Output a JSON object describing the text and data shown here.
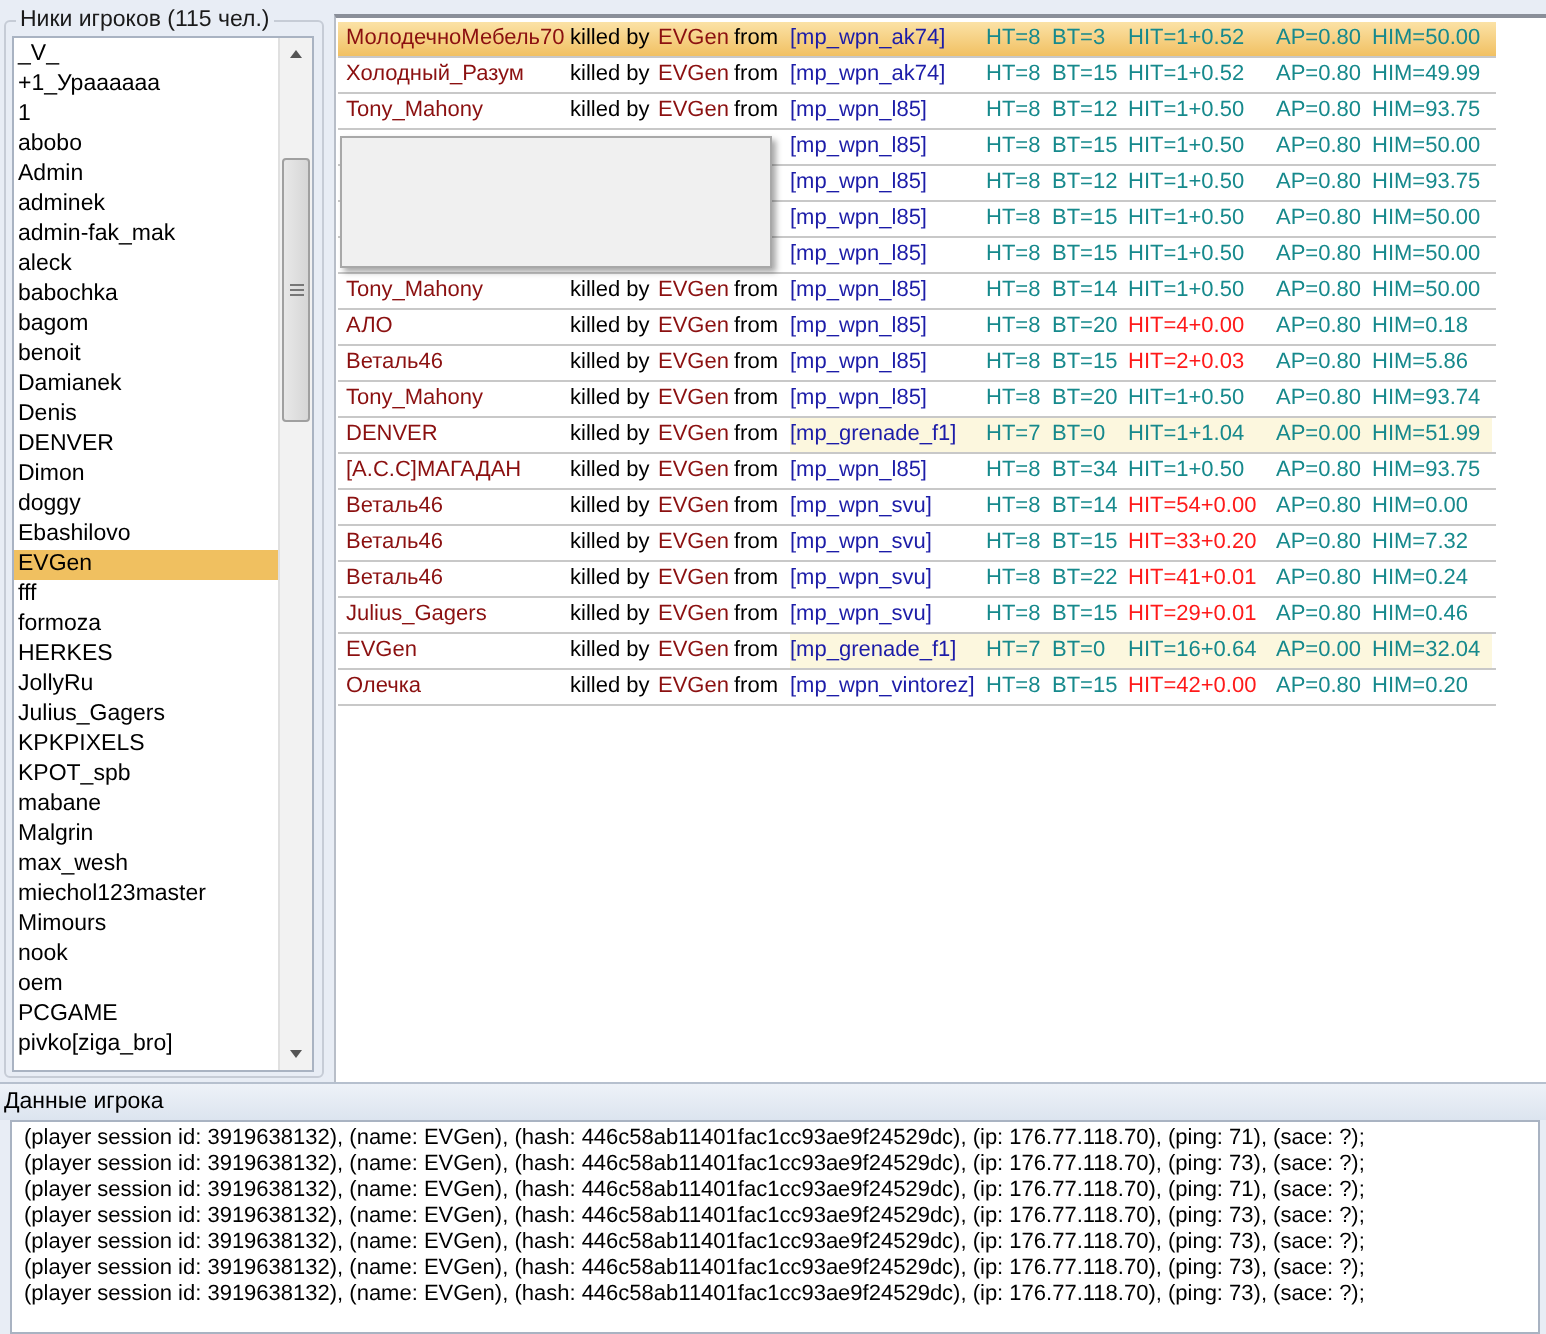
{
  "players_panel": {
    "title": "Ники игроков (115 чел.)",
    "items": [
      {
        "label": "_V_",
        "selected": false
      },
      {
        "label": "+1_Ураааааа",
        "selected": false
      },
      {
        "label": "1",
        "selected": false
      },
      {
        "label": "abobo",
        "selected": false
      },
      {
        "label": "Admin",
        "selected": false
      },
      {
        "label": "adminek",
        "selected": false
      },
      {
        "label": "admin-fak_mak",
        "selected": false
      },
      {
        "label": "aleck",
        "selected": false
      },
      {
        "label": "babochka",
        "selected": false
      },
      {
        "label": "bagom",
        "selected": false
      },
      {
        "label": "benoit",
        "selected": false
      },
      {
        "label": "Damianek",
        "selected": false
      },
      {
        "label": "Denis",
        "selected": false
      },
      {
        "label": "DENVER",
        "selected": false
      },
      {
        "label": "Dimon",
        "selected": false
      },
      {
        "label": "doggy",
        "selected": false
      },
      {
        "label": "Ebashilovo",
        "selected": false
      },
      {
        "label": "EVGen",
        "selected": true
      },
      {
        "label": "fff",
        "selected": false
      },
      {
        "label": "formoza",
        "selected": false
      },
      {
        "label": "HERKES",
        "selected": false
      },
      {
        "label": "JollyRu",
        "selected": false
      },
      {
        "label": "Julius_Gagers",
        "selected": false
      },
      {
        "label": "KPKPIXELS",
        "selected": false
      },
      {
        "label": "KPOT_spb",
        "selected": false
      },
      {
        "label": "mabane",
        "selected": false
      },
      {
        "label": "Malgrin",
        "selected": false
      },
      {
        "label": "max_wesh",
        "selected": false
      },
      {
        "label": "miechol123master",
        "selected": false
      },
      {
        "label": "Mimours",
        "selected": false
      },
      {
        "label": "nook",
        "selected": false
      },
      {
        "label": "oem",
        "selected": false
      },
      {
        "label": "PCGAME",
        "selected": false
      },
      {
        "label": "pivko[ziga_bro]",
        "selected": false
      }
    ]
  },
  "kills": [
    {
      "victim": "МолодечноМебель70",
      "verb": "killed by",
      "killer": "EVGen",
      "prep": "from",
      "weapon": "[mp_wpn_ak74]",
      "ht": "HT=8",
      "bt": "BT=3",
      "hit": "HIT=1+0.52",
      "ap": "AP=0.80",
      "him": "HIM=50.00",
      "hit_alert": false,
      "tinted": false,
      "selected": true
    },
    {
      "victim": "Холодный_Разум",
      "verb": "killed by",
      "killer": "EVGen",
      "prep": "from",
      "weapon": "[mp_wpn_ak74]",
      "ht": "HT=8",
      "bt": "BT=15",
      "hit": "HIT=1+0.52",
      "ap": "AP=0.80",
      "him": "HIM=49.99",
      "hit_alert": false,
      "tinted": false,
      "selected": false
    },
    {
      "victim": "Tony_Mahony",
      "verb": "killed by",
      "killer": "EVGen",
      "prep": "from",
      "weapon": "[mp_wpn_l85]",
      "ht": "HT=8",
      "bt": "BT=12",
      "hit": "HIT=1+0.50",
      "ap": "AP=0.80",
      "him": "HIM=93.75",
      "hit_alert": false,
      "tinted": false,
      "selected": false
    },
    {
      "weapon": "[mp_wpn_l85]",
      "ht": "HT=8",
      "bt": "BT=15",
      "hit": "HIT=1+0.50",
      "ap": "AP=0.80",
      "him": "HIM=50.00",
      "hit_alert": false,
      "tinted": false,
      "selected": false
    },
    {
      "weapon": "[mp_wpn_l85]",
      "ht": "HT=8",
      "bt": "BT=12",
      "hit": "HIT=1+0.50",
      "ap": "AP=0.80",
      "him": "HIM=93.75",
      "hit_alert": false,
      "tinted": false,
      "selected": false
    },
    {
      "weapon": "[mp_wpn_l85]",
      "ht": "HT=8",
      "bt": "BT=15",
      "hit": "HIT=1+0.50",
      "ap": "AP=0.80",
      "him": "HIM=50.00",
      "hit_alert": false,
      "tinted": false,
      "selected": false
    },
    {
      "weapon": "[mp_wpn_l85]",
      "ht": "HT=8",
      "bt": "BT=15",
      "hit": "HIT=1+0.50",
      "ap": "AP=0.80",
      "him": "HIM=50.00",
      "hit_alert": false,
      "tinted": false,
      "selected": false
    },
    {
      "victim": "Tony_Mahony",
      "verb": "killed by",
      "killer": "EVGen",
      "prep": "from",
      "weapon": "[mp_wpn_l85]",
      "ht": "HT=8",
      "bt": "BT=14",
      "hit": "HIT=1+0.50",
      "ap": "AP=0.80",
      "him": "HIM=50.00",
      "hit_alert": false,
      "tinted": false,
      "selected": false
    },
    {
      "victim": "АЛО",
      "verb": "killed by",
      "killer": "EVGen",
      "prep": "from",
      "weapon": "[mp_wpn_l85]",
      "ht": "HT=8",
      "bt": "BT=20",
      "hit": "HIT=4+0.00",
      "ap": "AP=0.80",
      "him": "HIM=0.18",
      "hit_alert": true,
      "tinted": false,
      "selected": false
    },
    {
      "victim": "Веталь46",
      "verb": "killed by",
      "killer": "EVGen",
      "prep": "from",
      "weapon": "[mp_wpn_l85]",
      "ht": "HT=8",
      "bt": "BT=15",
      "hit": "HIT=2+0.03",
      "ap": "AP=0.80",
      "him": "HIM=5.86",
      "hit_alert": true,
      "tinted": false,
      "selected": false
    },
    {
      "victim": "Tony_Mahony",
      "verb": "killed by",
      "killer": "EVGen",
      "prep": "from",
      "weapon": "[mp_wpn_l85]",
      "ht": "HT=8",
      "bt": "BT=20",
      "hit": "HIT=1+0.50",
      "ap": "AP=0.80",
      "him": "HIM=93.74",
      "hit_alert": false,
      "tinted": false,
      "selected": false
    },
    {
      "victim": "DENVER",
      "verb": "killed by",
      "killer": "EVGen",
      "prep": "from",
      "weapon": "[mp_grenade_f1]",
      "ht": "HT=7",
      "bt": "BT=0",
      "hit": "HIT=1+1.04",
      "ap": "AP=0.00",
      "him": "HIM=51.99",
      "hit_alert": false,
      "tinted": true,
      "selected": false
    },
    {
      "victim": "[A.C.C]МАГАДАН",
      "verb": "killed by",
      "killer": "EVGen",
      "prep": "from",
      "weapon": "[mp_wpn_l85]",
      "ht": "HT=8",
      "bt": "BT=34",
      "hit": "HIT=1+0.50",
      "ap": "AP=0.80",
      "him": "HIM=93.75",
      "hit_alert": false,
      "tinted": false,
      "selected": false
    },
    {
      "victim": "Веталь46",
      "verb": "killed by",
      "killer": "EVGen",
      "prep": "from",
      "weapon": "[mp_wpn_svu]",
      "ht": "HT=8",
      "bt": "BT=14",
      "hit": "HIT=54+0.00",
      "ap": "AP=0.80",
      "him": "HIM=0.00",
      "hit_alert": true,
      "tinted": false,
      "selected": false
    },
    {
      "victim": "Веталь46",
      "verb": "killed by",
      "killer": "EVGen",
      "prep": "from",
      "weapon": "[mp_wpn_svu]",
      "ht": "HT=8",
      "bt": "BT=15",
      "hit": "HIT=33+0.20",
      "ap": "AP=0.80",
      "him": "HIM=7.32",
      "hit_alert": true,
      "tinted": false,
      "selected": false
    },
    {
      "victim": "Веталь46",
      "verb": "killed by",
      "killer": "EVGen",
      "prep": "from",
      "weapon": "[mp_wpn_svu]",
      "ht": "HT=8",
      "bt": "BT=22",
      "hit": "HIT=41+0.01",
      "ap": "AP=0.80",
      "him": "HIM=0.24",
      "hit_alert": true,
      "tinted": false,
      "selected": false
    },
    {
      "victim": "Julius_Gagers",
      "verb": "killed by",
      "killer": "EVGen",
      "prep": "from",
      "weapon": "[mp_wpn_svu]",
      "ht": "HT=8",
      "bt": "BT=15",
      "hit": "HIT=29+0.01",
      "ap": "AP=0.80",
      "him": "HIM=0.46",
      "hit_alert": true,
      "tinted": false,
      "selected": false
    },
    {
      "victim": "EVGen",
      "verb": "killed by",
      "killer": "EVGen",
      "prep": "from",
      "weapon": "[mp_grenade_f1]",
      "ht": "HT=7",
      "bt": "BT=0",
      "hit": "HIT=16+0.64",
      "ap": "AP=0.00",
      "him": "HIM=32.04",
      "hit_alert": false,
      "tinted": true,
      "selected": false
    },
    {
      "victim": "Олечка",
      "verb": "killed by",
      "killer": "EVGen",
      "prep": "from",
      "weapon": "[mp_wpn_vintorez]",
      "ht": "HT=8",
      "bt": "BT=15",
      "hit": "HIT=42+0.00",
      "ap": "AP=0.80",
      "him": "HIM=0.20",
      "hit_alert": true,
      "tinted": false,
      "selected": false
    }
  ],
  "player_data": {
    "title": "Данные игрока",
    "lines": [
      "(player session id: 3919638132), (name: EVGen), (hash: 446c58ab11401fac1cc93ae9f24529dc), (ip: 176.77.118.70), (ping: 71), (sace: ?);",
      "(player session id: 3919638132), (name: EVGen), (hash: 446c58ab11401fac1cc93ae9f24529dc), (ip: 176.77.118.70), (ping: 73), (sace: ?);",
      "(player session id: 3919638132), (name: EVGen), (hash: 446c58ab11401fac1cc93ae9f24529dc), (ip: 176.77.118.70), (ping: 71), (sace: ?);",
      "(player session id: 3919638132), (name: EVGen), (hash: 446c58ab11401fac1cc93ae9f24529dc), (ip: 176.77.118.70), (ping: 73), (sace: ?);",
      "(player session id: 3919638132), (name: EVGen), (hash: 446c58ab11401fac1cc93ae9f24529dc), (ip: 176.77.118.70), (ping: 73), (sace: ?);",
      "(player session id: 3919638132), (name: EVGen), (hash: 446c58ab11401fac1cc93ae9f24529dc), (ip: 176.77.118.70), (ping: 73), (sace: ?);",
      "(player session id: 3919638132), (name: EVGen), (hash: 446c58ab11401fac1cc93ae9f24529dc), (ip: 176.77.118.70), (ping: 73), (sace: ?);"
    ]
  }
}
